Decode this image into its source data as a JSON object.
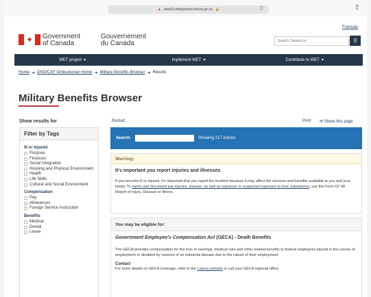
{
  "browser": {
    "url": "www3.ombudsman.forces.gc.ca",
    "lock_icon": "lock-icon",
    "leaf_icon": "maple-leaf-icon"
  },
  "header": {
    "language_link": "Français",
    "gov_en_line1": "Government",
    "gov_en_line2": "of Canada",
    "gov_fr_line1": "Gouvernement",
    "gov_fr_line2": "du Canada",
    "search_placeholder": "Search Canada.ca",
    "flag_color": "#d52b1e"
  },
  "menu": {
    "items": [
      {
        "label": "WET project"
      },
      {
        "label": "Implement WET"
      },
      {
        "label": "Contribute to WET"
      }
    ]
  },
  "breadcrumb": {
    "home": "Home",
    "ombudsman_home": "DND/CAF Ombudsman Home",
    "browser": "Military Benefits Browser",
    "current": "Results"
  },
  "page": {
    "title": "Military Benefits Browser",
    "show_results": "Show results for",
    "restart": "Restart",
    "print": "Print",
    "share": "Share this page"
  },
  "filters": {
    "title": "Filter by Tags",
    "groups": [
      {
        "title": "Ill or Injured",
        "items": [
          "Purpose",
          "Finances",
          "Social Integration",
          "Housing and Physical Environment",
          "Health",
          "Life Skills",
          "Cultural and Social Environment"
        ]
      },
      {
        "title": "Compensation",
        "items": [
          "Pay",
          "Allowances",
          "Foreign Service Instruction"
        ]
      },
      {
        "title": "Benefits",
        "items": [
          "Medical",
          "Dental",
          "Leave"
        ]
      }
    ]
  },
  "search": {
    "label": "Search:",
    "count": "Showing 217 entries"
  },
  "warning": {
    "header": "Warning:",
    "title": "It's important you report injuries and illnesses",
    "text_before": "If you become ill or injured, it's important that you report the incident because it may affect the services and benefits available to you and your family. To ",
    "link": "report and document any injuries, disease, as well as exposure or suspected exposure to toxic substances",
    "text_after": ", use the Form CF 98 Report of Injury, Disease or Illness."
  },
  "eligible": {
    "header": "You may be eligible for:",
    "title_italic": "Government Employee's Compensation Act",
    "title_rest": " (GECA) - Death Benefits",
    "text": "The GECA provides compensation for the loss of earnings, medical care and other related benefits to federal employees injured in the course of employment or disabled by reasons of an industrial disease due to the nature of their employment.",
    "contact_label": "Contact",
    "contact_before": "For more details on GECA coverage, refer to the ",
    "contact_link": "Labour website",
    "contact_after": " or call your GECA regional office."
  }
}
